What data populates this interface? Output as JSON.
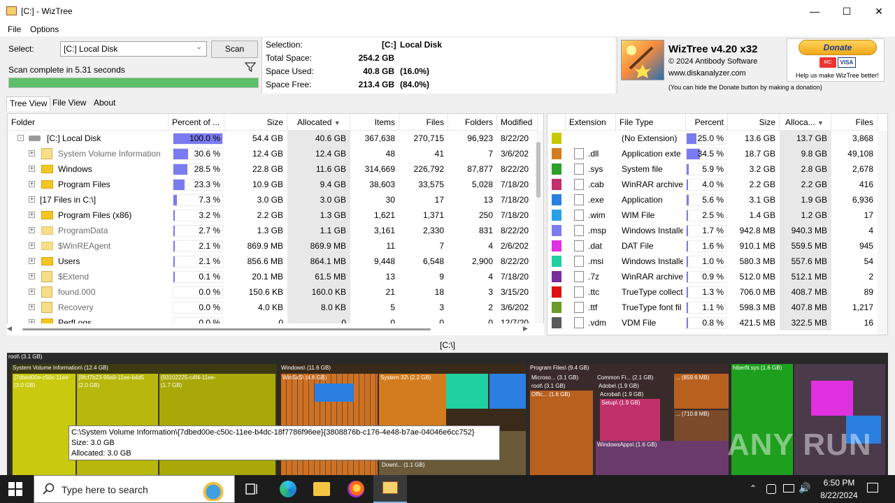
{
  "window": {
    "title": "[C:]  - WizTree"
  },
  "menu": [
    "File",
    "Options"
  ],
  "select": {
    "label": "Select:",
    "value": "[C:] Local Disk",
    "scan": "Scan",
    "status": "Scan complete in 5.31 seconds",
    "progress": 1.0
  },
  "info": {
    "selection_label": "Selection:",
    "selection_drive": "[C:]",
    "selection_name": "Local Disk",
    "rows": [
      {
        "label": "Total Space:",
        "value": "254.2 GB",
        "pct": ""
      },
      {
        "label": "Space Used:",
        "value": "40.8 GB",
        "pct": "(16.0%)"
      },
      {
        "label": "Space Free:",
        "value": "213.4 GB",
        "pct": "(84.0%)"
      }
    ]
  },
  "brand": {
    "name": "WizTree v4.20 x32",
    "copyright": "© 2024 Antibody Software",
    "site": "www.diskanalyzer.com",
    "hint": "(You can hide the Donate button by making a donation)",
    "donate": "Donate",
    "donate_caption": "Help us make WizTree better!",
    "card1": "MC",
    "card2": "VISA"
  },
  "tabs": [
    "Tree View",
    "File View",
    "About"
  ],
  "tree": {
    "headers": [
      "Folder",
      "Percent of ...",
      "Size",
      "Allocated",
      "Items",
      "Files",
      "Folders",
      "Modified"
    ],
    "rows": [
      {
        "name": "[C:] Local Disk",
        "pct": "100.0 %",
        "p": 1.0,
        "size": "54.4 GB",
        "alloc": "40.6 GB",
        "items": "367,638",
        "files": "270,715",
        "folders": "96,923",
        "mod": "8/22/20",
        "kind": "drive",
        "grey": false
      },
      {
        "name": "System Volume Information",
        "pct": "30.6 %",
        "p": 0.306,
        "size": "12.4 GB",
        "alloc": "12.4 GB",
        "items": "48",
        "files": "41",
        "folders": "7",
        "mod": "3/6/202",
        "kind": "sys",
        "grey": true
      },
      {
        "name": "Windows",
        "pct": "28.5 %",
        "p": 0.285,
        "size": "22.8 GB",
        "alloc": "11.6 GB",
        "items": "314,669",
        "files": "226,792",
        "folders": "87,877",
        "mod": "8/22/20",
        "kind": "folder",
        "grey": false
      },
      {
        "name": "Program Files",
        "pct": "23.3 %",
        "p": 0.233,
        "size": "10.9 GB",
        "alloc": "9.4 GB",
        "items": "38,603",
        "files": "33,575",
        "folders": "5,028",
        "mod": "7/18/20",
        "kind": "folder",
        "grey": false
      },
      {
        "name": "[17 Files in C:\\]",
        "pct": "7.3 %",
        "p": 0.073,
        "size": "3.0 GB",
        "alloc": "3.0 GB",
        "items": "30",
        "files": "17",
        "folders": "13",
        "mod": "7/18/20",
        "kind": "none",
        "grey": false
      },
      {
        "name": "Program Files (x86)",
        "pct": "3.2 %",
        "p": 0.032,
        "size": "2.2 GB",
        "alloc": "1.3 GB",
        "items": "1,621",
        "files": "1,371",
        "folders": "250",
        "mod": "7/18/20",
        "kind": "folder",
        "grey": false
      },
      {
        "name": "ProgramData",
        "pct": "2.7 %",
        "p": 0.027,
        "size": "1.3 GB",
        "alloc": "1.1 GB",
        "items": "3,161",
        "files": "2,330",
        "folders": "831",
        "mod": "8/22/20",
        "kind": "folderlt",
        "grey": true
      },
      {
        "name": "$WinREAgent",
        "pct": "2.1 %",
        "p": 0.021,
        "size": "869.9 MB",
        "alloc": "869.9 MB",
        "items": "11",
        "files": "7",
        "folders": "4",
        "mod": "2/6/202",
        "kind": "folderlt",
        "grey": true
      },
      {
        "name": "Users",
        "pct": "2.1 %",
        "p": 0.021,
        "size": "856.6 MB",
        "alloc": "864.1 MB",
        "items": "9,448",
        "files": "6,548",
        "folders": "2,900",
        "mod": "8/22/20",
        "kind": "folder",
        "grey": false
      },
      {
        "name": "$Extend",
        "pct": "0.1 %",
        "p": 0.001,
        "size": "20.1 MB",
        "alloc": "61.5 MB",
        "items": "13",
        "files": "9",
        "folders": "4",
        "mod": "7/18/20",
        "kind": "sys",
        "grey": true
      },
      {
        "name": "found.000",
        "pct": "0.0 %",
        "p": 0.0,
        "size": "150.6 KB",
        "alloc": "160.0 KB",
        "items": "21",
        "files": "18",
        "folders": "3",
        "mod": "3/15/20",
        "kind": "sys",
        "grey": true
      },
      {
        "name": "Recovery",
        "pct": "0.0 %",
        "p": 0.0,
        "size": "4.0 KB",
        "alloc": "8.0 KB",
        "items": "5",
        "files": "3",
        "folders": "2",
        "mod": "3/6/202",
        "kind": "sys",
        "grey": true
      },
      {
        "name": "PerfLogs",
        "pct": "0.0 %",
        "p": 0.0,
        "size": "0",
        "alloc": "0",
        "items": "0",
        "files": "0",
        "folders": "0",
        "mod": "12/7/20",
        "kind": "folder",
        "grey": false
      }
    ]
  },
  "ext": {
    "headers": [
      "Extension",
      "File Type",
      "Percent",
      "Size",
      "Alloca...",
      "Files"
    ],
    "rows": [
      {
        "color": "#c8c800",
        "icon": "none",
        "ext": "",
        "type": "(No Extension)",
        "pct": "25.0 %",
        "p": 0.25,
        "size": "13.6 GB",
        "alloc": "13.7 GB",
        "files": "3,868"
      },
      {
        "color": "#d27c1e",
        "icon": "dll",
        "ext": ".dll",
        "type": "Application exte",
        "pct": "34.5 %",
        "p": 0.345,
        "size": "18.7 GB",
        "alloc": "9.8 GB",
        "files": "49,108"
      },
      {
        "color": "#2aa12a",
        "icon": "sys",
        "ext": ".sys",
        "type": "System file",
        "pct": "5.9 %",
        "p": 0.059,
        "size": "3.2 GB",
        "alloc": "2.8 GB",
        "files": "2,678"
      },
      {
        "color": "#c0306a",
        "icon": "cab",
        "ext": ".cab",
        "type": "WinRAR archive",
        "pct": "4.0 %",
        "p": 0.04,
        "size": "2.2 GB",
        "alloc": "2.2 GB",
        "files": "416"
      },
      {
        "color": "#2a7fe0",
        "icon": "exe",
        "ext": ".exe",
        "type": "Application",
        "pct": "5.6 %",
        "p": 0.056,
        "size": "3.1 GB",
        "alloc": "1.9 GB",
        "files": "6,936"
      },
      {
        "color": "#2aa0e8",
        "icon": "doc",
        "ext": ".wim",
        "type": "WIM File",
        "pct": "2.5 %",
        "p": 0.025,
        "size": "1.4 GB",
        "alloc": "1.2 GB",
        "files": "17"
      },
      {
        "color": "#7b7bf0",
        "icon": "msp",
        "ext": ".msp",
        "type": "Windows Installe",
        "pct": "1.7 %",
        "p": 0.017,
        "size": "942.8 MB",
        "alloc": "940.3 MB",
        "files": "4"
      },
      {
        "color": "#e030e0",
        "icon": "doc",
        "ext": ".dat",
        "type": "DAT File",
        "pct": "1.6 %",
        "p": 0.016,
        "size": "910.1 MB",
        "alloc": "559.5 MB",
        "files": "945"
      },
      {
        "color": "#20d0a0",
        "icon": "msi",
        "ext": ".msi",
        "type": "Windows Installe",
        "pct": "1.0 %",
        "p": 0.01,
        "size": "580.3 MB",
        "alloc": "557.6 MB",
        "files": "54"
      },
      {
        "color": "#7a2a9a",
        "icon": "cab",
        "ext": ".7z",
        "type": "WinRAR archive",
        "pct": "0.9 %",
        "p": 0.009,
        "size": "512.0 MB",
        "alloc": "512.1 MB",
        "files": "2"
      },
      {
        "color": "#e01010",
        "icon": "font",
        "ext": ".ttc",
        "type": "TrueType collecti",
        "pct": "1.3 %",
        "p": 0.013,
        "size": "706.0 MB",
        "alloc": "408.7 MB",
        "files": "89"
      },
      {
        "color": "#6a9a2a",
        "icon": "font",
        "ext": ".ttf",
        "type": "TrueType font fil",
        "pct": "1.1 %",
        "p": 0.011,
        "size": "598.3 MB",
        "alloc": "407.8 MB",
        "files": "1,217"
      },
      {
        "color": "#5a5a5a",
        "icon": "doc",
        "ext": ".vdm",
        "type": "VDM File",
        "pct": "0.8 %",
        "p": 0.008,
        "size": "421.5 MB",
        "alloc": "322.5 MB",
        "files": "16"
      }
    ]
  },
  "breadcrumb": "[C:\\]",
  "treemap": {
    "labels": {
      "root": "root\\ (3.1 GB)",
      "svi": "System Volume Information\\ (12.4 GB)",
      "b1a": "{7dbed00e-c50c-11ee",
      "b1b": "(3.0 GB)",
      "b2a": "{9fcf7b23-99a9-11ee-b4d5",
      "b2b": "(2.0 GB)",
      "b3a": "{93102225-c4f4-11ee-",
      "b3b": "(1.7 GB)",
      "win": "Windows\\ (11.6 GB)",
      "winsxs": "WinSxS\\ (4.6 GB)",
      "sys32": "System 32\\ (2.2 GB)",
      "pf": "Program Files\\ (9.4 GB)",
      "micro": "Microso... (3.1 GB)",
      "office": "Offic... (1.6 GB)",
      "common": "Common Fi... (2.1 GB)",
      "adobe": "Adobe\\ (1.9 GB)",
      "acrobat": "Acrobat\\ (1.9 GB)",
      "setup": "Setup\\ (1.9 GB)",
      "dots1": "... (859.6 MB)",
      "dots2": "... (710.8 MB)",
      "winapps": "WindowsApps\\ (1.6 GB)",
      "downl": "Downl... (1.1 GB)",
      "hiber": "hiberfil.sys (1.6 GB)"
    }
  },
  "tooltip": {
    "path": "C:\\System Volume Information\\{7dbed00e-c50c-11ee-b4dc-18f7786f96ee}{3808876b-c176-4e48-b7ae-04046e6cc752}",
    "size": "Size: 3.0 GB",
    "alloc": "Allocated: 3.0 GB"
  },
  "watermark": "ANY RUN",
  "taskbar": {
    "search_placeholder": "Type here to search",
    "time": "6:50 PM",
    "date": "8/22/2024"
  }
}
